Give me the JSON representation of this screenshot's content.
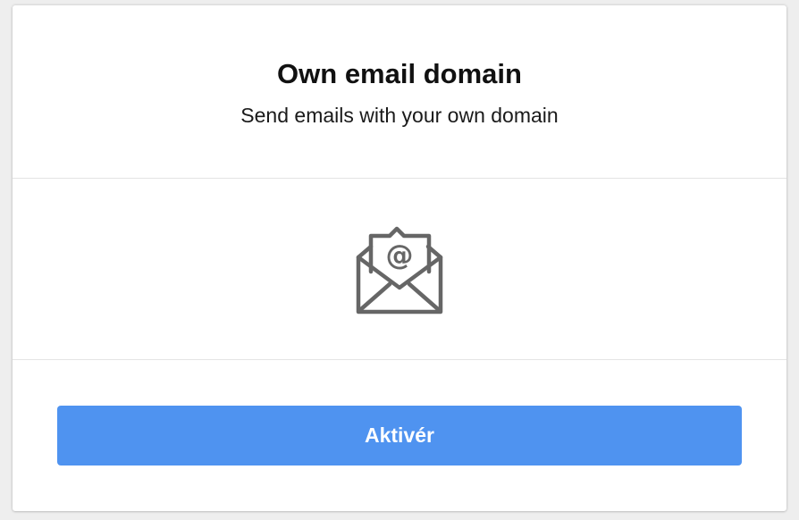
{
  "card": {
    "title": "Own email domain",
    "subtitle": "Send emails with your own domain",
    "icon": "envelope-at-icon",
    "button_label": "Aktivér"
  },
  "colors": {
    "button_bg": "#4f93f0",
    "icon_stroke": "#666666"
  }
}
